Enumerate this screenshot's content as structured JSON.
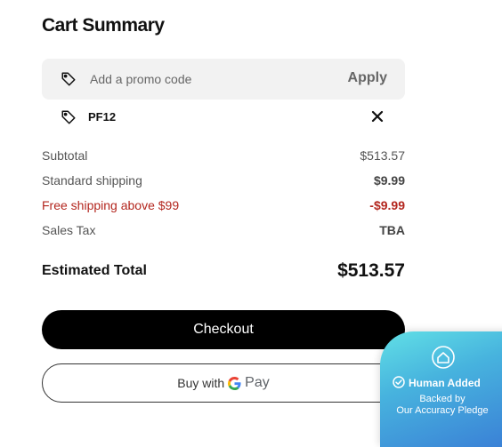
{
  "cart": {
    "title": "Cart Summary"
  },
  "promo": {
    "placeholder": "Add a promo code",
    "apply_label": "Apply",
    "applied_code": "PF12"
  },
  "summary": {
    "subtotal": {
      "label": "Subtotal",
      "value": "$513.57"
    },
    "shipping": {
      "label": "Standard shipping",
      "value": "$9.99"
    },
    "discount": {
      "label": "Free shipping above $99",
      "value": "-$9.99"
    },
    "tax": {
      "label": "Sales Tax",
      "value": "TBA"
    }
  },
  "total": {
    "label": "Estimated Total",
    "value": "$513.57"
  },
  "buttons": {
    "checkout": "Checkout",
    "gpay_prefix": "Buy with",
    "gpay_brand_g": "G",
    "gpay_brand_pay": "Pay"
  },
  "badge": {
    "headline": "Human Added",
    "line1": "Backed by",
    "line2": "Our Accuracy Pledge"
  },
  "colors": {
    "accent_black": "#000000",
    "discount_red": "#b3261e",
    "badge_teal": "#4fc6e0",
    "badge_blue": "#3a7fd6"
  }
}
